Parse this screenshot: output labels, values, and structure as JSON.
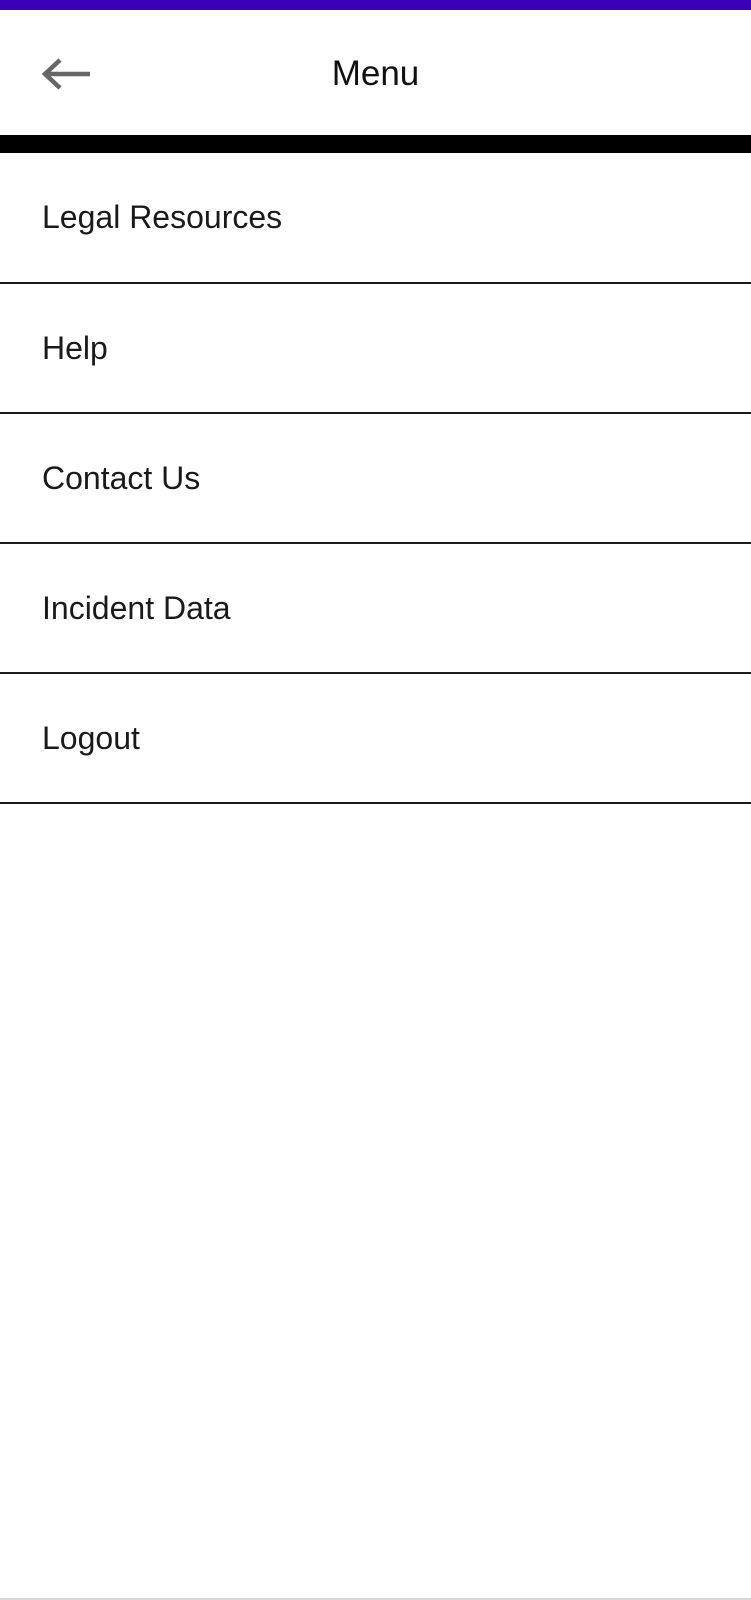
{
  "header": {
    "title": "Menu",
    "back_icon": "arrow-left-icon"
  },
  "menu": {
    "items": [
      {
        "label": "Legal Resources"
      },
      {
        "label": "Help"
      },
      {
        "label": "Contact Us"
      },
      {
        "label": "Incident Data"
      },
      {
        "label": "Logout"
      }
    ]
  },
  "colors": {
    "status_bar": "#3a00b8",
    "divider": "#000000",
    "background": "#ffffff",
    "text": "#1a1a1a"
  }
}
